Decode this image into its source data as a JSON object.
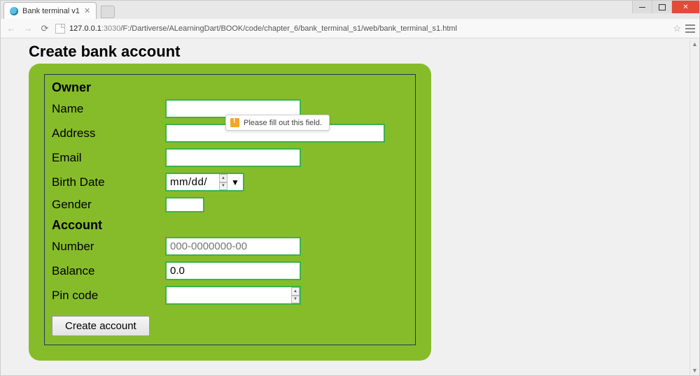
{
  "browser": {
    "tab_title": "Bank terminal v1",
    "url_host": "127.0.0.1",
    "url_port": ":3030",
    "url_path": "/F:/Dartiverse/ALearningDart/BOOK/code/chapter_6/bank_terminal_s1/web/bank_terminal_s1.html"
  },
  "page": {
    "title": "Create bank account"
  },
  "form": {
    "validation_message": "Please fill out this field.",
    "owner": {
      "heading": "Owner",
      "name_label": "Name",
      "name_value": "",
      "address_label": "Address",
      "address_value": "",
      "email_label": "Email",
      "email_value": "",
      "birthdate_label": "Birth Date",
      "birthdate_value": "mm/dd/",
      "gender_label": "Gender",
      "gender_value": ""
    },
    "account": {
      "heading": "Account",
      "number_label": "Number",
      "number_placeholder": "000-0000000-00",
      "balance_label": "Balance",
      "balance_value": "0.0",
      "pincode_label": "Pin code",
      "pincode_value": ""
    },
    "submit_label": "Create account"
  },
  "colors": {
    "panel_green": "#86bc2a",
    "field_border_green": "#3bb24a",
    "form_border_navy": "#1b3a56",
    "tooltip_warn": "#f5a623"
  }
}
